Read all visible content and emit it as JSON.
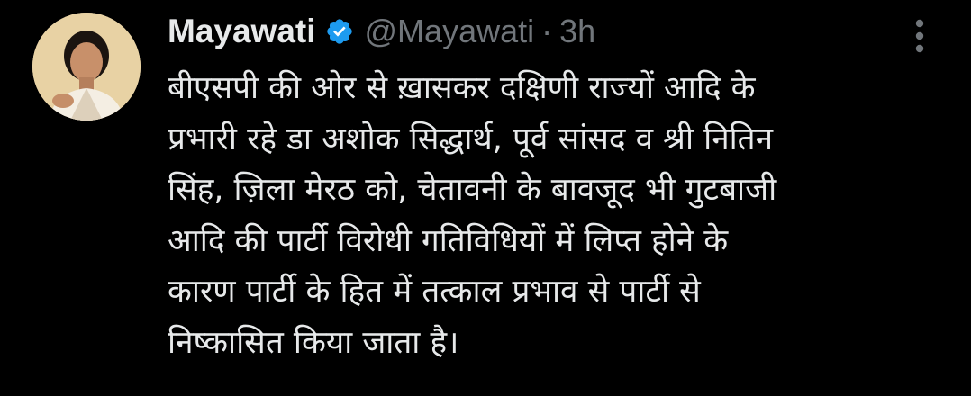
{
  "tweet": {
    "author": {
      "display_name": "Mayawati",
      "handle": "@Mayawati",
      "verified_icon": "verified-badge-icon",
      "avatar_icon": "avatar"
    },
    "separator": "·",
    "time": "3h",
    "more_icon": "more-vertical-icon",
    "text_lines": [
      "बीएसपी की ओर से ख़ासकर दक्षिणी राज्यों आदि के",
      "प्रभारी रहे डा अशोक सिद्धार्थ, पूर्व सांसद व श्री नितिन",
      "सिंह, ज़िला मेरठ को, चेतावनी के बावजूद भी गुटबाजी",
      "आदि की पार्टी विरोधी गतिविधियों में लिप्त होने के",
      "कारण पार्टी के हित में तत्काल प्रभाव से पार्टी से",
      "निष्कासित किया जाता है।"
    ]
  },
  "colors": {
    "background": "#000000",
    "primary_text": "#e7e9ea",
    "secondary_text": "#71767b",
    "verified_blue": "#1d9bf0"
  }
}
